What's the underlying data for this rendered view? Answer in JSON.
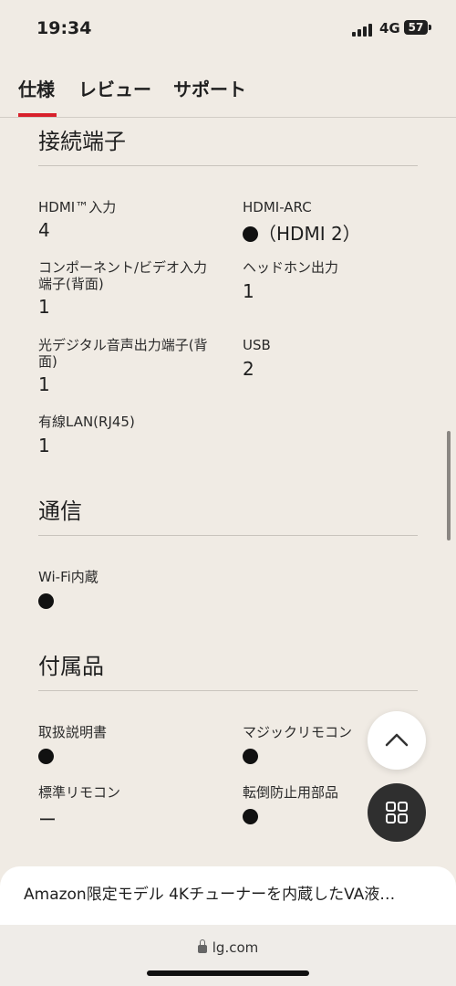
{
  "status": {
    "time": "19:34",
    "network": "4G",
    "battery": "57"
  },
  "tabs": [
    {
      "label": "仕様",
      "active": true
    },
    {
      "label": "レビュー",
      "active": false
    },
    {
      "label": "サポート",
      "active": false
    }
  ],
  "sections": {
    "ports": {
      "title": "接続端子",
      "items": {
        "hdmi": {
          "label": "HDMI™入力",
          "value": "4"
        },
        "hdmi_arc": {
          "label": "HDMI-ARC",
          "value": "（HDMI 2）"
        },
        "component": {
          "label": "コンポーネント/ビデオ入力端子(背面)",
          "label_line1": "コンポーネント/ビデオ入力",
          "label_line2": "端子(背面)",
          "value": "1"
        },
        "headphone": {
          "label": "ヘッドホン出力",
          "value": "1"
        },
        "optical": {
          "label": "光デジタル音声出力端子(背面)",
          "label_line1": "光デジタル音声出力端子(背",
          "label_line2": "面)",
          "value": "1"
        },
        "usb": {
          "label": "USB",
          "value": "2"
        },
        "lan": {
          "label": "有線LAN(RJ45)",
          "value": "1"
        }
      }
    },
    "comm": {
      "title": "通信",
      "items": {
        "wifi": {
          "label": "Wi-Fi内蔵",
          "value": "●"
        }
      }
    },
    "accessories": {
      "title": "付属品",
      "items": {
        "manual": {
          "label": "取扱説明書",
          "value": "●"
        },
        "magic_remote": {
          "label": "マジックリモコン",
          "value": "●"
        },
        "std_remote": {
          "label": "標準リモコン",
          "value": "ー"
        },
        "anti_tip": {
          "label": "転倒防止用部品",
          "value": "●"
        }
      }
    }
  },
  "bottom_bar": {
    "product_title": "Amazon限定モデル 4Kチューナーを内蔵したVA液…"
  },
  "browser": {
    "url": "lg.com"
  },
  "colors": {
    "accent": "#d8202b",
    "background": "#f0ebe4"
  },
  "icons": {
    "scroll_top": "chevron-up-icon",
    "menu": "grid-icon",
    "secure": "lock-icon"
  }
}
